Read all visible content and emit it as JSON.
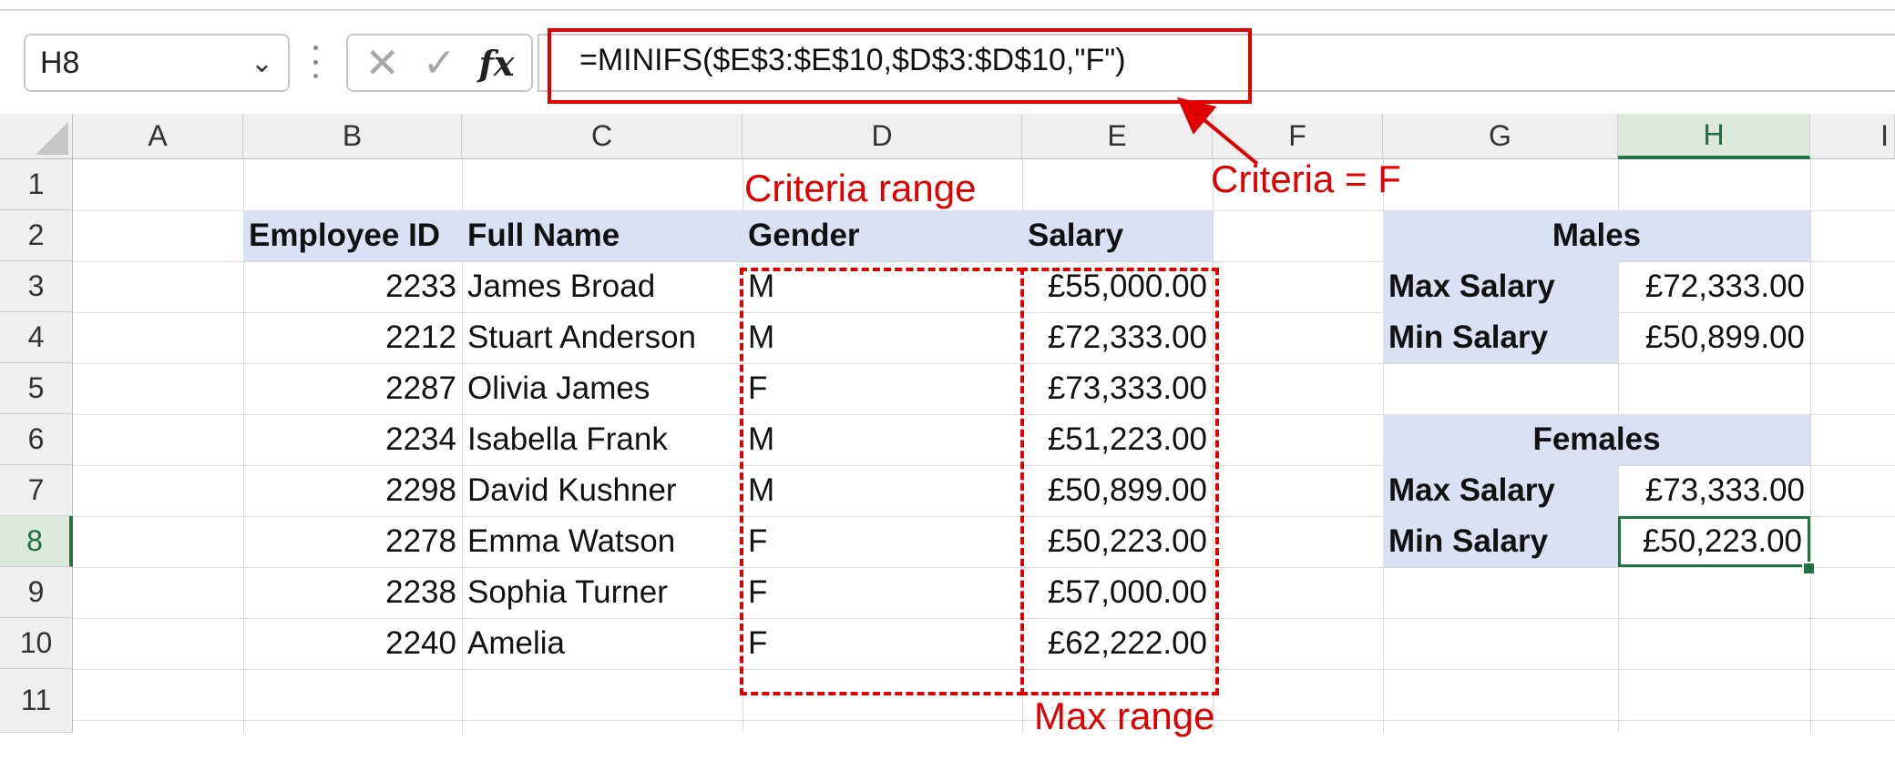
{
  "formula_bar": {
    "name_box": "H8",
    "formula": "=MINIFS($E$3:$E$10,$D$3:$D$10,\"F\")"
  },
  "column_headers": [
    "A",
    "B",
    "C",
    "D",
    "E",
    "F",
    "G",
    "H",
    "I"
  ],
  "row_headers": [
    "1",
    "2",
    "3",
    "4",
    "5",
    "6",
    "7",
    "8",
    "9",
    "10",
    "11"
  ],
  "table": {
    "headers": [
      "Employee ID",
      "Full Name",
      "Gender",
      "Salary"
    ],
    "rows": [
      {
        "id": "2233",
        "name": "James Broad",
        "gender": "M",
        "salary": "£55,000.00"
      },
      {
        "id": "2212",
        "name": "Stuart Anderson",
        "gender": "M",
        "salary": "£72,333.00"
      },
      {
        "id": "2287",
        "name": "Olivia James",
        "gender": "F",
        "salary": "£73,333.00"
      },
      {
        "id": "2234",
        "name": "Isabella Frank",
        "gender": "M",
        "salary": "£51,223.00"
      },
      {
        "id": "2298",
        "name": "David Kushner",
        "gender": "M",
        "salary": "£50,899.00"
      },
      {
        "id": "2278",
        "name": "Emma Watson",
        "gender": "F",
        "salary": "£50,223.00"
      },
      {
        "id": "2238",
        "name": "Sophia Turner",
        "gender": "F",
        "salary": "£57,000.00"
      },
      {
        "id": "2240",
        "name": "Amelia",
        "gender": "F",
        "salary": "£62,222.00"
      }
    ]
  },
  "summary": {
    "males": {
      "title": "Males",
      "max_label": "Max Salary",
      "max_value": "£72,333.00",
      "min_label": "Min Salary",
      "min_value": "£50,899.00"
    },
    "females": {
      "title": "Females",
      "max_label": "Max Salary",
      "max_value": "£73,333.00",
      "min_label": "Min Salary",
      "min_value": "£50,223.00"
    }
  },
  "annotations": {
    "criteria_range": "Criteria range",
    "criteria": "Criteria = F",
    "max_range": "Max range"
  },
  "colors": {
    "annotation_red": "#e00000",
    "header_fill": "#dae1f3",
    "excel_green": "#217346"
  }
}
